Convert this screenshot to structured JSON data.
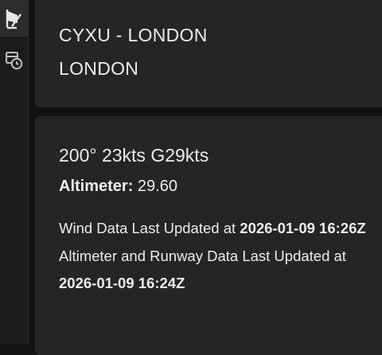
{
  "sidebar": {
    "items": [
      {
        "icon": "wind-sock-icon",
        "active": true
      },
      {
        "icon": "clock-history-icon",
        "active": false
      }
    ]
  },
  "station": {
    "code_line": "CYXU - LONDON",
    "city": "LONDON"
  },
  "conditions": {
    "wind": "200° 23kts G29kts",
    "altimeter_label": "Altimeter:",
    "altimeter_value": "29.60",
    "wind_updated_prefix": "Wind Data Last Updated at",
    "wind_updated_time": "2026-01-09 16:26Z",
    "alt_runway_updated_prefix": "Altimeter and Runway Data Last Updated at",
    "alt_runway_updated_time": "2026-01-09 16:24Z"
  }
}
